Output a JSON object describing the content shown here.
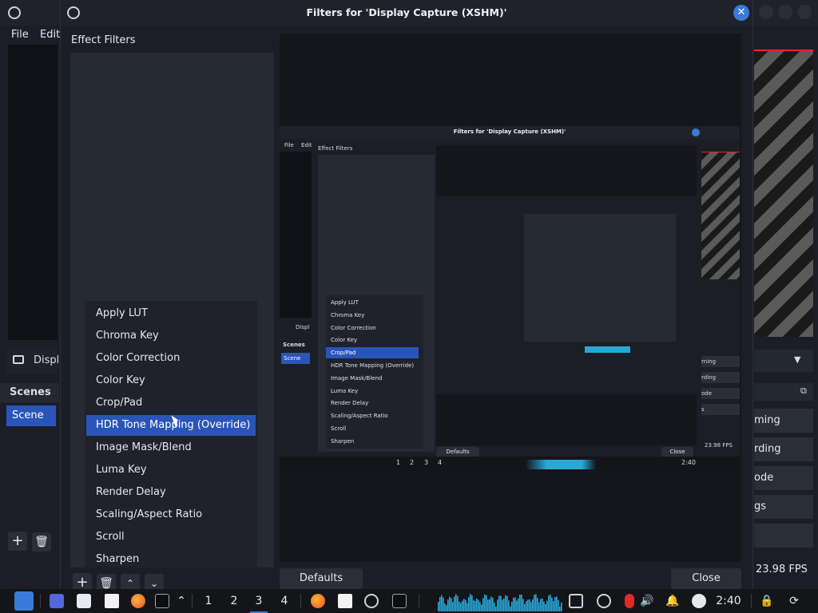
{
  "main_window": {
    "menu": [
      "File",
      "Edit"
    ],
    "source_label": "Displ",
    "scenes_header": "Scenes",
    "scene_selected": "Scene",
    "right_buttons": [
      "ming",
      "rding",
      "ode",
      "gs"
    ],
    "fps": "23.98 FPS"
  },
  "dialog": {
    "title": "Filters for 'Display Capture (XSHM)'",
    "effect_filters_label": "Effect Filters",
    "filters": [
      "Apply LUT",
      "Chroma Key",
      "Color Correction",
      "Color Key",
      "Crop/Pad",
      "HDR Tone Mapping (Override)",
      "Image Mask/Blend",
      "Luma Key",
      "Render Delay",
      "Scaling/Aspect Ratio",
      "Scroll",
      "Sharpen"
    ],
    "selected_filter": "HDR Tone Mapping (Override)",
    "defaults_button": "Defaults",
    "close_button": "Close"
  },
  "nested": {
    "title": "Filters for 'Display Capture (XSHM)'",
    "effect_filters_label": "Effect Filters",
    "filters": [
      "Apply LUT",
      "Chroma Key",
      "Color Correction",
      "Color Key",
      "Crop/Pad",
      "HDR Tone Mapping (Override)",
      "Image Mask/Blend",
      "Luma Key",
      "Render Delay",
      "Scaling/Aspect Ratio",
      "Scroll",
      "Sharpen"
    ],
    "selected": "Crop/Pad",
    "defaults_button": "Defaults",
    "close_button": "Close",
    "scenes_header": "Scenes",
    "scene": "Scene",
    "fps": "23.98 FPS",
    "menu": [
      "File",
      "Edit"
    ],
    "source_label": "Displ",
    "right_buttons": [
      "rning",
      "rding",
      "ode",
      "s"
    ],
    "workspaces": [
      "1",
      "2",
      "3",
      "4"
    ],
    "clock": "2:40"
  },
  "taskbar": {
    "workspaces": [
      "1",
      "2",
      "3",
      "4"
    ],
    "active_workspace": "3",
    "clock": "2:40"
  },
  "colors": {
    "accent": "#2a55b8",
    "close_blue": "#3a7ad8",
    "record_red": "#e02a2a",
    "audio_cyan": "#29a8d8"
  }
}
